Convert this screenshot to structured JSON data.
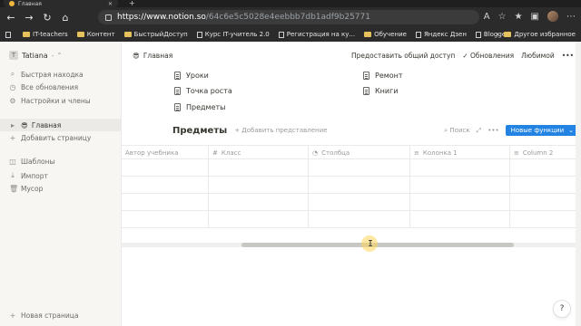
{
  "browser": {
    "tab_title": "Главная",
    "url_host": "https://www.notion.so",
    "url_path": "/64c6e5c5028e4eebbb7db1adf9b25771",
    "bookmarks": [
      "IT-teachers",
      "Контент",
      "БыстрыйДоступ",
      "Курс IT-учитель 2.0",
      "Регистрация на ку...",
      "Обучение",
      "Яндекс Дзен",
      "Blogger"
    ],
    "bookmarks_other": "Другое избранное"
  },
  "sidebar": {
    "workspace": "Tatiana",
    "workspace_initial": "T",
    "items": [
      {
        "label": "Быстрая находка",
        "icon": "search-icon"
      },
      {
        "label": "Все обновления",
        "icon": "clock-icon"
      },
      {
        "label": "Настройки и члены",
        "icon": "gear-icon"
      }
    ],
    "pages": [
      {
        "label": "Главная",
        "emoji": "😎"
      }
    ],
    "add_page": "Добавить страницу",
    "bottom": [
      {
        "label": "Шаблоны",
        "icon": "template-icon"
      },
      {
        "label": "Импорт",
        "icon": "import-icon"
      },
      {
        "label": "Мусор",
        "icon": "trash-icon"
      }
    ],
    "new_page": "Новая страница"
  },
  "topbar": {
    "breadcrumb": "Главная",
    "breadcrumb_emoji": "😎",
    "share": "Предоставить общий доступ",
    "updates": "Обновления",
    "favorite": "Любимой",
    "more": "•••"
  },
  "links": {
    "left": [
      "Уроки",
      "Точка роста",
      "Предметы"
    ],
    "right": [
      "Ремонт",
      "Книги"
    ]
  },
  "database": {
    "title": "Предметы",
    "add_view": "+ Добавить представление",
    "search": "Поиск",
    "expand": "⤢",
    "more": "•••",
    "new_button": "Новые функции",
    "columns": [
      {
        "label": "Автор учебника",
        "icon": ""
      },
      {
        "label": "Класс",
        "icon": "#"
      },
      {
        "label": "Столбца",
        "icon": "◔"
      },
      {
        "label": "Колонка 1",
        "icon": "≡"
      },
      {
        "label": "Column 2",
        "icon": "≡"
      }
    ],
    "row_count": 4
  },
  "help_label": "?",
  "colors": {
    "accent": "#2383e2",
    "sidebar_bg": "#f7f6f3",
    "text": "#37352f"
  }
}
